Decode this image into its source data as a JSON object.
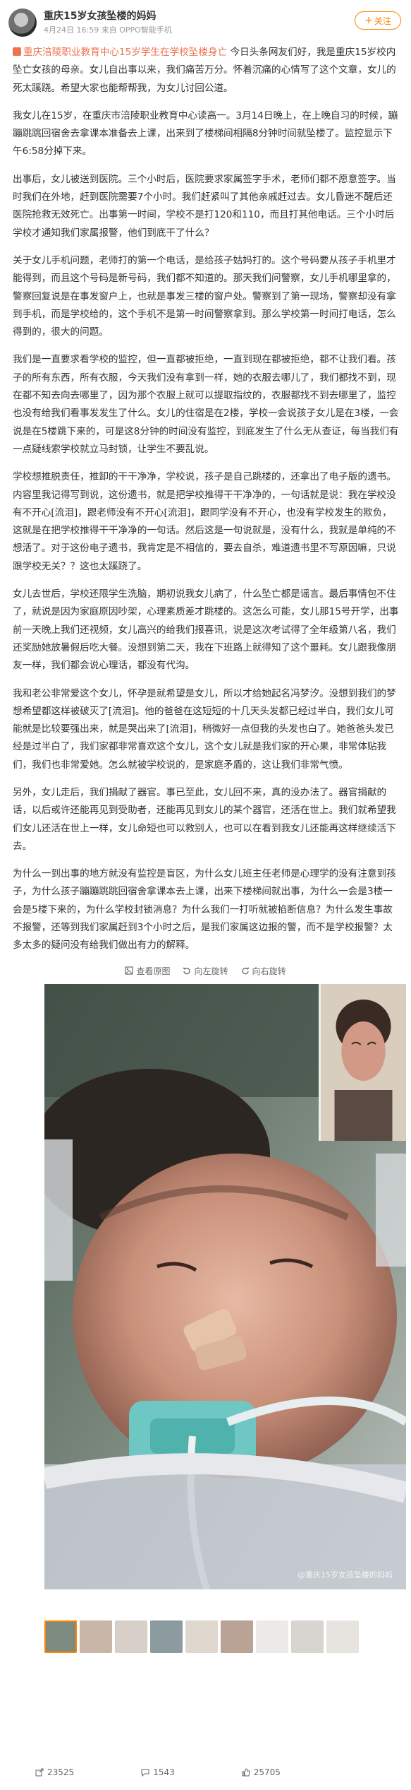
{
  "post": {
    "author": "重庆15岁女孩坠楼的妈妈",
    "meta": "4月24日 16:59 来自 OPPO智能手机",
    "follow_label": "关注",
    "topic": "重庆涪陵职业教育中心15岁学生在学校坠楼身亡",
    "paragraphs": [
      "今日头条网友们好，我是重庆15岁校内坠亡女孩的母亲。女儿自出事以来，我们痛苦万分。怀着沉痛的心情写了这个文章，女儿的死太蹊跷。希望大家也能帮帮我，为女儿讨回公道。",
      "我女儿在15岁，在重庆市涪陵职业教育中心读高一。3月14日晚上，在上晚自习的时候，蹦蹦跳跳回宿舍去拿课本准备去上课，出来到了楼梯间相隔8分钟时间就坠楼了。监控显示下午6:58分掉下来。",
      "出事后，女儿被送到医院。三个小时后，医院要求家属签字手术，老师们都不愿意签字。当时我们在外地，赶到医院需要7个小时。我们赶紧叫了其他亲戚赶过去。女儿昏迷不醒后还医院抢救无效死亡。出事第一时间，学校不是打120和110，而且打其他电话。三个小时后学校才通知我们家属报警，他们到底干了什么？",
      "关于女儿手机问题，老师打的第一个电话，是给孩子姑妈打的。这个号码要从孩子手机里才能得到，而且这个号码是新号码，我们都不知道的。那天我们问警察，女儿手机哪里拿的，警察回复说是在事发窗户上，也就是事发三楼的窗户处。警察到了第一现场，警察却没有拿到手机，而是学校给的，这个手机不是第一时间警察拿到。那么学校第一时间打电话，怎么得到的，很大的问题。",
      "我们是一直要求看学校的监控，但一直都被拒绝，一直到现在都被拒绝，都不让我们看。孩子的所有东西，所有衣服，今天我们没有拿到一样，她的衣服去哪儿了，我们都找不到，现在都不知去向去哪里了，因为那个衣服上就可以提取指纹的，衣服都找不到去哪里了，监控也没有给我们看事发发生了什么。女儿的住宿是在2楼，学校一会说孩子女儿是在3楼，一会说是在5楼跳下来的，可是这8分钟的时间没有监控，到底发生了什么无从查证，每当我们有一点疑线索学校就立马封锁，让学生不要乱说。",
      "学校想推脱责任，推卸的干干净净，学校说，孩子是自己跳楼的，还拿出了电子版的遗书。内容里我记得写到说，这份遗书，就是把学校推得干干净净的，一句话就是说：我在学校没有不开心[流泪]，跟老师没有不开心[流泪]，跟同学没有不开心，也没有学校发生的欺负，这就是在把学校推得干干净净的一句话。然后这是一句说就是，没有什么，我就是单纯的不想活了。对于这份电子遗书，我肯定是不相信的，要去自杀，难道遗书里不写原因嘛，只说跟学校无关？？这也太蹊跷了。",
      "女儿去世后，学校还限学生洗脑，期初说我女儿病了，什么坠亡都是谣言。最后事情包不住了，就说是因为家庭原因吵架，心理素质差才跳楼的。这怎么可能，女儿那15号开学，出事前一天晚上我们还视频，女儿高兴的给我们报喜讯，说是这次考试得了全年级第八名，我们还奖励她放暑假后吃大餐。没想到第二天，我在下班路上就得知了这个噩耗。女儿跟我像朋友一样，我们都会说心理话，都没有代沟。",
      "我和老公非常爱这个女儿，怀孕是就希望是女儿，所以才给她起名冯梦汐。没想到我们的梦想希望都这样被破灭了[流泪]。他的爸爸在这短短的十几天头发都已经过半白，我们女儿可能就是比较要强出来，就是哭出来了[流泪]，稍微好一点但我的头发也白了。她爸爸头发已经是过半白了，我们家都非常喜欢这个女儿，这个女儿就是我们家的开心果，非常体贴我们，我们也非常爱她。怎么就被学校说的，是家庭矛盾的，这让我们非常气愤。",
      "另外，女儿走后，我们捐献了器官。事已至此，女儿回不来，真的没办法了。器官捐献的话，以后或许还能再见到受助者，还能再见到女儿的某个器官，还活在世上。我们就希望我们女儿还活在世上一样，女儿命短也可以救别人，也可以在看到我女儿还能再这样继续活下去。",
      "为什么一到出事的地方就没有监控是盲区，为什么女儿班主任老师是心理学的没有注意到孩子，为什么孩子蹦蹦跳跳回宿舍拿课本去上课，出来下楼梯间就出事，为什么一会是3楼一会是5楼下来的，为什么学校封锁消息？为什么我们一打听就被掐断信息？为什么发生事故不报警，还等到我们家属赶到3个小时之后，是我们家属这边报的警，而不是学校报警？太多太多的疑问没有给我们做出有力的解释。"
    ],
    "mid_actions": [
      {
        "icon": "view-original-icon",
        "label": "查看原图"
      },
      {
        "icon": "rotate-left-icon",
        "label": "向左旋转"
      },
      {
        "icon": "rotate-right-icon",
        "label": "向右旋转"
      }
    ],
    "watermark": "@重庆15岁女孩坠楼的妈妈",
    "footer": {
      "share_count": "23525",
      "comment_count": "1543",
      "like_count": "25705"
    }
  }
}
